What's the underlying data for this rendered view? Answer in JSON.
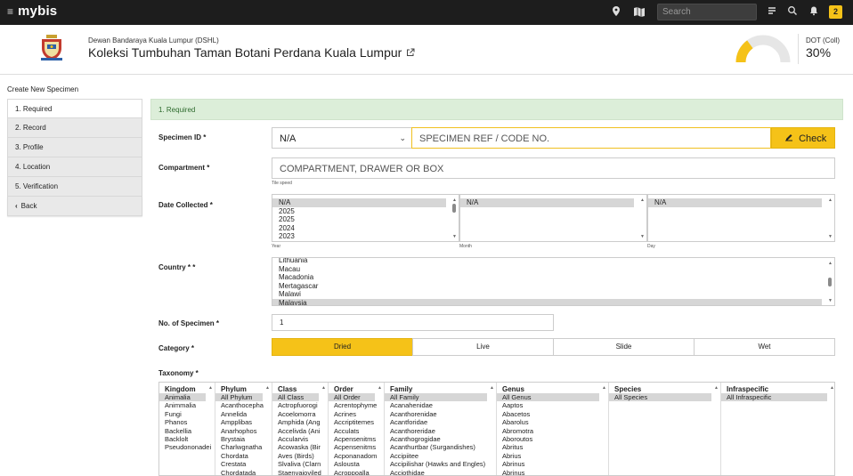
{
  "topbar": {
    "brand": "mybis",
    "search_placeholder": "Search",
    "notification_count": "2",
    "icons": [
      "menu-icon",
      "location-pin-icon",
      "map-icon",
      "chat-icon",
      "search-icon",
      "bell-icon"
    ]
  },
  "header": {
    "organization": "Dewan Bandaraya Kuala Lumpur (DSHL)",
    "collection_title": "Koleksi Tumbuhan Taman Botani Perdana Kuala Lumpur",
    "kpi_label": "DOT (Coll)",
    "kpi_value": "30%",
    "kpi_fraction": 0.3,
    "accent_color": "#f5c218"
  },
  "page_title": "Create New Specimen",
  "sidebar": {
    "items": [
      {
        "label": "1. Required"
      },
      {
        "label": "2. Record"
      },
      {
        "label": "3. Profile"
      },
      {
        "label": "4. Location"
      },
      {
        "label": "5. Verification"
      }
    ],
    "back_label": "Back"
  },
  "form": {
    "section_title": "1. Required",
    "specimen_id_label": "Specimen ID *",
    "specimen_prefix_value": "N/A",
    "specimen_ref_placeholder": "SPECIMEN REF / CODE NO.",
    "check_label": "Check",
    "compartment_label": "Compartment *",
    "compartment_placeholder": "COMPARTMENT, DRAWER OR BOX",
    "compartment_hint": "Tile speed",
    "date_label": "Date Collected *",
    "year_options": [
      "N/A",
      "2025",
      "2025",
      "2024",
      "2023"
    ],
    "year_selected": "N/A",
    "month_selected": "N/A",
    "day_selected": "N/A",
    "year_hint": "Year",
    "month_hint": "Month",
    "day_hint": "Day",
    "country_label": "Country * *",
    "country_options": [
      "Lithuania",
      "Macau",
      "Macadonia",
      "Mertagascar",
      "Malawi",
      "Malaysia"
    ],
    "country_selected": "Malaysia",
    "num_specimen_label": "No. of Specimen *",
    "num_specimen_value": "1",
    "category_label": "Category *",
    "categories": [
      "Dried",
      "Live",
      "Slide",
      "Wet"
    ],
    "category_selected": "Dried",
    "taxonomy_label": "Taxonomy *"
  },
  "taxonomy": [
    {
      "head": "Kingdom",
      "items": [
        "Animalia",
        "Animmalia",
        "Fungi",
        "Phanos",
        "Backellia",
        "Backlolt",
        "Pseudononadei"
      ],
      "selected": 0
    },
    {
      "head": "Phylum",
      "items": [
        "All Phylum",
        "Acanthocepha",
        "Annelida",
        "Ampplibas",
        "Anarhophos",
        "Brystaia",
        "Charlwgnatha",
        "Chordata",
        "Crestata",
        "Chordatada"
      ],
      "selected": 0
    },
    {
      "head": "Class",
      "items": [
        "All Class",
        "Actropfuorogi",
        "Acoelomorra",
        "Amphida (Ang",
        "Accelivda (Ani",
        "Accularvis",
        "Acowaska (Bir",
        "Aves (Birds)",
        "Slvaliva (Clarn",
        "Staenvaioviled"
      ],
      "selected": 0
    },
    {
      "head": "Order",
      "items": [
        "All Order",
        "Acrentophyme",
        "Acrines",
        "Accriptitemes",
        "Acculats",
        "Acpensenitms",
        "Acpensenitms",
        "Acponanadom",
        "Aslousta",
        "Acroppoalla"
      ],
      "selected": 0
    },
    {
      "head": "Family",
      "items": [
        "All Family",
        "Acanahenidae",
        "Acanthorenidae",
        "Acantforidae",
        "Acanthoreridae",
        "Acanthogrogidae",
        "Acanthurtbar (Surgandishes)",
        "Accipiitee",
        "Accipilishar (Hawks and Engles)",
        "Acciothidae"
      ],
      "selected": 0
    },
    {
      "head": "Genus",
      "items": [
        "All Genus",
        "Aaptos",
        "Abacetos",
        "Abarolus",
        "Abromotra",
        "Aboroutos",
        "Abritus",
        "Abrius",
        "Abrinus",
        "Abrinus"
      ],
      "selected": 0
    },
    {
      "head": "Species",
      "items": [
        "All Species"
      ],
      "selected": 0
    },
    {
      "head": "Infraspecific",
      "items": [
        "All Infraspecific"
      ],
      "selected": 0
    }
  ]
}
